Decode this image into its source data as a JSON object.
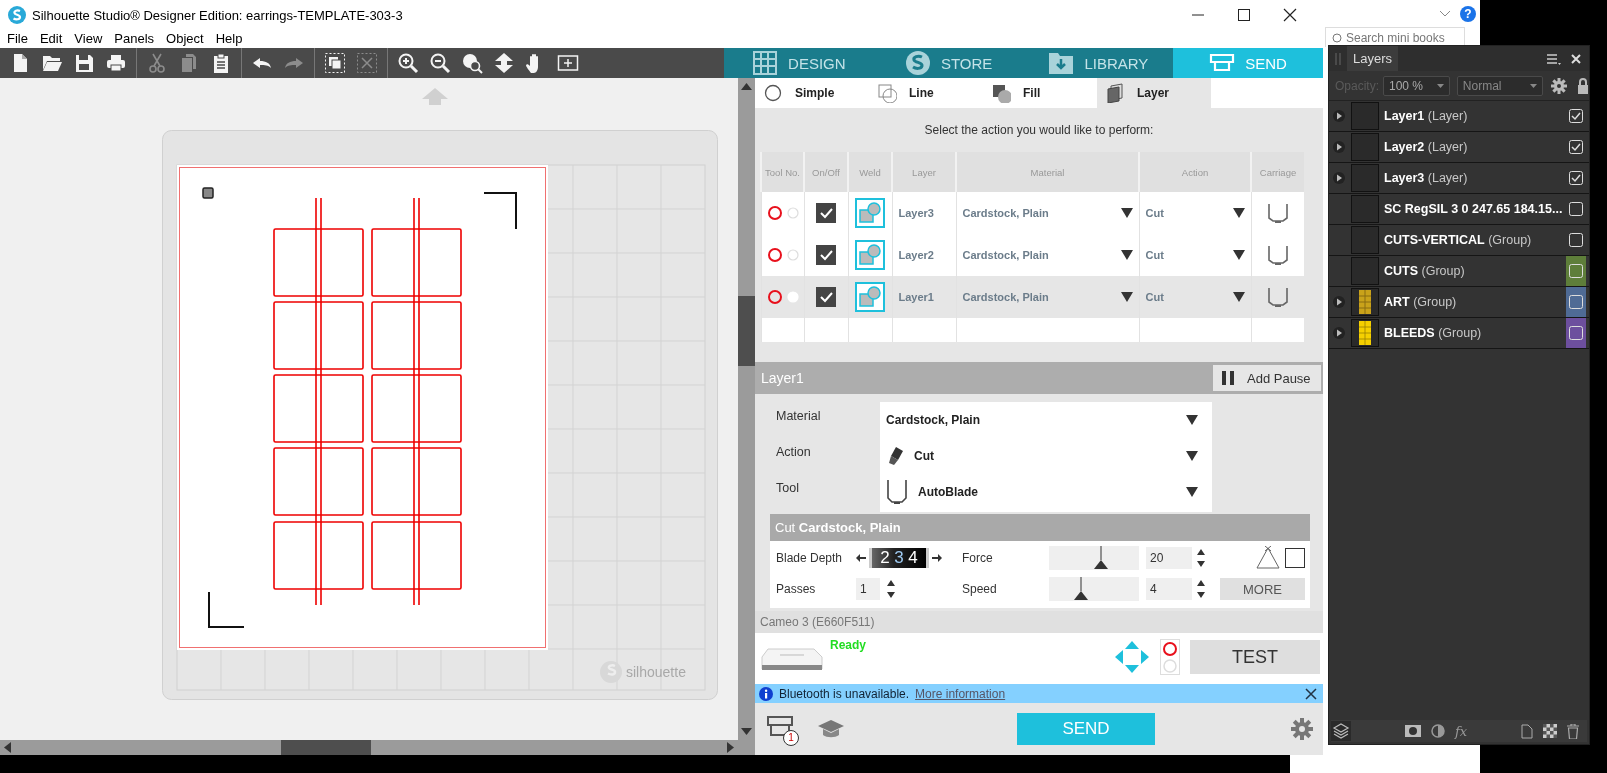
{
  "window": {
    "title": "Silhouette Studio® Designer Edition: earrings-TEMPLATE-303-3"
  },
  "menu": [
    "File",
    "Edit",
    "View",
    "Panels",
    "Object",
    "Help"
  ],
  "toolbar": [
    [
      {
        "kind": "new",
        "disabled": false
      },
      {
        "kind": "open",
        "disabled": false
      },
      {
        "kind": "save",
        "disabled": false
      },
      {
        "kind": "print",
        "disabled": false
      }
    ],
    [
      {
        "kind": "cut",
        "disabled": true
      },
      {
        "kind": "copy",
        "disabled": true
      },
      {
        "kind": "paste",
        "disabled": false
      }
    ],
    [
      {
        "kind": "undo",
        "disabled": false
      },
      {
        "kind": "redo",
        "disabled": true
      }
    ],
    [
      {
        "kind": "group",
        "disabled": false
      },
      {
        "kind": "ungroup",
        "disabled": true
      }
    ],
    [
      {
        "kind": "zoom_in",
        "disabled": false
      },
      {
        "kind": "zoom_out",
        "disabled": false
      },
      {
        "kind": "zoom_select",
        "disabled": false
      },
      {
        "kind": "pan_vertical",
        "disabled": false
      },
      {
        "kind": "pan",
        "disabled": false
      },
      {
        "kind": "fit",
        "disabled": false
      }
    ]
  ],
  "mode_tabs": [
    {
      "label": "DESIGN",
      "selected": false
    },
    {
      "label": "STORE",
      "selected": false
    },
    {
      "label": "LIBRARY",
      "selected": false
    },
    {
      "label": "SEND",
      "selected": true
    }
  ],
  "send_tabs": [
    {
      "label": "Simple",
      "selected": false
    },
    {
      "label": "Line",
      "selected": false
    },
    {
      "label": "Fill",
      "selected": false
    },
    {
      "label": "Layer",
      "selected": true
    }
  ],
  "instruction": "Select the action you would like to perform:",
  "table": {
    "columns": [
      "Tool No.",
      "On/Off",
      "Weld",
      "Layer",
      "Material",
      "Action",
      "Carriage"
    ],
    "rows": [
      {
        "layer": "Layer3",
        "material": "Cardstock, Plain",
        "action": "Cut",
        "on": true,
        "selected": false
      },
      {
        "layer": "Layer2",
        "material": "Cardstock, Plain",
        "action": "Cut",
        "on": true,
        "selected": false
      },
      {
        "layer": "Layer1",
        "material": "Cardstock, Plain",
        "action": "Cut",
        "on": true,
        "selected": true
      }
    ]
  },
  "layer_settings": {
    "title": "Layer1",
    "add_pause": "Add Pause",
    "fields": [
      {
        "label": "Material",
        "value": "Cardstock, Plain"
      },
      {
        "label": "Action",
        "value": "Cut"
      },
      {
        "label": "Tool",
        "value": "AutoBlade"
      }
    ]
  },
  "cut_settings": {
    "title": "Cut **Cardstock, Plain**",
    "blade_depth": {
      "label": "Blade Depth",
      "digits": [
        "2",
        "3",
        "4"
      ]
    },
    "force": {
      "label": "Force",
      "level": 0.58,
      "value": "20"
    },
    "passes": {
      "label": "Passes",
      "value": "1"
    },
    "speed": {
      "label": "Speed",
      "level": 0.36,
      "value": "4"
    },
    "more": "MORE",
    "option_box": {
      "checked": false
    }
  },
  "machine": {
    "name": "Cameo 3 (E660F511)",
    "status": "Ready",
    "test": "TEST"
  },
  "notice": {
    "text": "Bluetooth is unavailable.",
    "link": "More information"
  },
  "footer": {
    "queue_badge": "1",
    "send": "SEND"
  },
  "mat": {
    "logo": "silhouette"
  },
  "browser": {
    "search_placeholder": "Search mini books",
    "help": "?"
  },
  "layers_panel": {
    "title": "Layers",
    "opacity_label": "Opacity:",
    "opacity": "100 %",
    "blend": "Normal",
    "fx": "fx",
    "items": [
      {
        "name": "Layer1",
        "type": "(Layer)",
        "expandable": true,
        "visible": true,
        "kind": "blank"
      },
      {
        "name": "Layer2",
        "type": "(Layer)",
        "expandable": true,
        "visible": true,
        "kind": "blank"
      },
      {
        "name": "Layer3",
        "type": "(Layer)",
        "expandable": true,
        "visible": true,
        "kind": "blank"
      },
      {
        "name": "SC RegSIL 3 0 247.65 184.15...",
        "expandable": false,
        "visible": false,
        "kind": "blank"
      },
      {
        "name": "CUTS-VERTICAL",
        "type": "(Group)",
        "expandable": false,
        "visible": false,
        "kind": "blank"
      },
      {
        "name": "CUTS",
        "type": "(Group)",
        "expandable": false,
        "visible": false,
        "kind": "blank",
        "color": "#5e7e3a"
      },
      {
        "name": "ART",
        "type": "(Group)",
        "expandable": true,
        "visible": false,
        "kind": "pattern",
        "color": "#4f6b95"
      },
      {
        "name": "BLEEDS",
        "type": "(Group)",
        "expandable": true,
        "visible": false,
        "kind": "grid",
        "color": "#6d4f9e"
      }
    ]
  }
}
